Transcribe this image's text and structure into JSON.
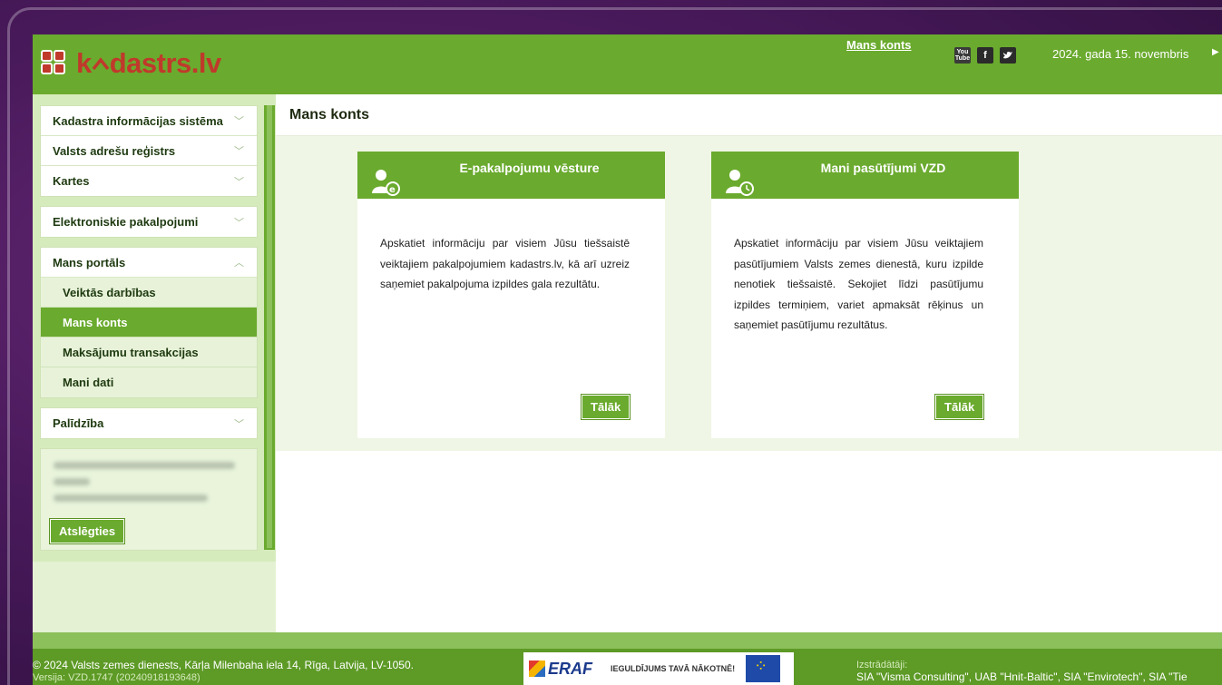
{
  "header": {
    "logo_prefix": "k",
    "logo_suffix": "dastrs.lv",
    "account_link": "Mans konts",
    "date": "2024. gada 15. novembris",
    "social_icons": [
      "youtube-icon",
      "facebook-icon",
      "twitter-icon"
    ]
  },
  "sidebar": {
    "group1": [
      {
        "label": "Kadastra informācijas sistēma"
      },
      {
        "label": "Valsts adrešu reģistrs"
      },
      {
        "label": "Kartes"
      }
    ],
    "group2": [
      {
        "label": "Elektroniskie pakalpojumi"
      }
    ],
    "portal": {
      "label": "Mans portāls",
      "items": [
        {
          "label": "Veiktās darbības"
        },
        {
          "label": "Mans konts"
        },
        {
          "label": "Maksājumu transakcijas"
        },
        {
          "label": "Mani dati"
        }
      ]
    },
    "help": {
      "label": "Palīdzība"
    },
    "logout_label": "Atslēgties"
  },
  "main": {
    "title": "Mans konts",
    "cards": [
      {
        "title": "E-pakalpojumu vēsture",
        "text": "Apskatiet informāciju par visiem Jūsu tiešsaistē veiktajiem pakalpojumiem kadastrs.lv, kā arī uzreiz saņemiet pakalpojuma izpildes gala rezultātu.",
        "button": "Tālāk"
      },
      {
        "title": "Mani pasūtījumi VZD",
        "text": "Apskatiet informāciju par visiem Jūsu veiktajiem pasūtījumiem Valsts zemes dienestā, kuru izpilde nenotiek tiešsaistē. Sekojiet līdzi pasūtījumu izpildes termiņiem, variet apmaksāt rēķinus un saņemiet pasūtījumu rezultātus.",
        "button": "Tālāk"
      }
    ]
  },
  "footer": {
    "copyright": "© 2024 Valsts zemes dienests, Kārļa Milenbaha iela 14, Rīga, Latvija, LV-1050.",
    "version": "Versija: VZD.1747 (20240918193648)",
    "eraf": "ERAF",
    "eraf_slogan": "IEGULDĪJUMS TAVĀ NĀKOTNĒ!",
    "developers_label": "Izstrādātāji:",
    "developers": "SIA \"Visma Consulting\", UAB \"Hnit-Baltic\", SIA \"Envirotech\", SIA \"Tie"
  },
  "colors": {
    "brand_green": "#6aaa2e",
    "logo_red": "#c0392b",
    "light_green": "#e4f1d2"
  }
}
